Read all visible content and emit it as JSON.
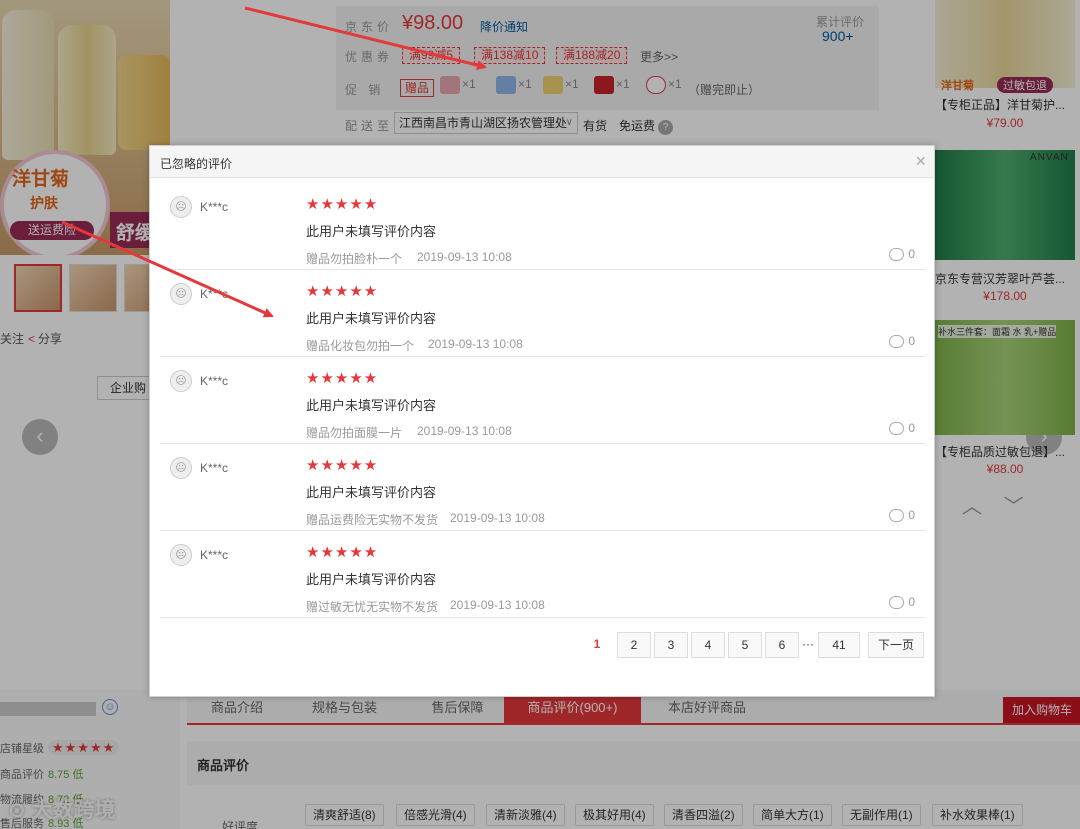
{
  "hero": {
    "caption_main": "洋甘菊",
    "caption_sub": "护肤",
    "caption_badge": "送运费险",
    "caption_side": "舒缓"
  },
  "actions": {
    "follow": "关注",
    "share": "分享",
    "enterprise_buy": "企业购"
  },
  "price": {
    "jd_label": "京东价",
    "jd_price": "¥98.00",
    "notify": "降价通知",
    "total_reviews_label": "累计评价",
    "total_reviews": "900+",
    "coupon_label": "优惠券",
    "coupons": [
      "满99减5",
      "满138减10",
      "满188减20"
    ],
    "more": "更多>>",
    "promo_label": "促 销",
    "gift_tag": "赠品",
    "gifts": [
      "×1",
      "×1",
      "×1",
      "×1",
      "×1"
    ],
    "gift_note": "（赠完即止）",
    "ship_to_label": "配送至",
    "address": "江西南昌市青山湖区扬农管理处",
    "stock": "有货",
    "shipping": "免运费"
  },
  "recommend": [
    {
      "badge1": "洋甘菊",
      "badge2": "过敏包退",
      "title": "【专柜正品】洋甘菊护...",
      "price": "¥79.00"
    },
    {
      "brand": "ANVAN",
      "title": "京东专营汉芳翠叶芦荟...",
      "price": "¥178.00"
    },
    {
      "badge": "补水三件套：面霜 水 乳+赠品",
      "title": "【专柜品质过敏包退】...",
      "price": "¥88.00"
    }
  ],
  "tabs": [
    "商品介绍",
    "规格与包装",
    "售后保障",
    "商品评价(900+)",
    "本店好评商品"
  ],
  "cart_button": "加入购物车",
  "store": {
    "rating_label": "店铺星级",
    "product_score_label": "商品评价",
    "product_score": "8.75 低",
    "logistics_label": "物流履约",
    "logistics": "8.72 低",
    "service_label": "售后服务",
    "service": "8.93 低"
  },
  "review_section": {
    "title": "商品评价",
    "praise_label": "好评度",
    "tags": [
      "清爽舒适(8)",
      "倍感光滑(4)",
      "清新淡雅(4)",
      "极其好用(4)",
      "清香四溢(2)",
      "简单大方(1)",
      "无副作用(1)",
      "补水效果棒(1)"
    ]
  },
  "watermark": "大数跨境",
  "modal": {
    "title": "已忽略的评价",
    "close": "×",
    "reviews": [
      {
        "user": "K***c",
        "stars": "★★★★★",
        "text": "此用户未填写评价内容",
        "product": "赠品勿拍脸朴一个",
        "time": "2019-09-13 10:08",
        "comments": "0"
      },
      {
        "user": "K***c",
        "stars": "★★★★★",
        "text": "此用户未填写评价内容",
        "product": "赠品化妆包勿拍一个",
        "time": "2019-09-13 10:08",
        "comments": "0"
      },
      {
        "user": "K***c",
        "stars": "★★★★★",
        "text": "此用户未填写评价内容",
        "product": "赠品勿拍面膜一片",
        "time": "2019-09-13 10:08",
        "comments": "0"
      },
      {
        "user": "K***c",
        "stars": "★★★★★",
        "text": "此用户未填写评价内容",
        "product": "赠品运费险无实物不发货",
        "time": "2019-09-13 10:08",
        "comments": "0"
      },
      {
        "user": "K***c",
        "stars": "★★★★★",
        "text": "此用户未填写评价内容",
        "product": "赠过敏无忧无实物不发货",
        "time": "2019-09-13 10:08",
        "comments": "0"
      }
    ],
    "pager": {
      "current": "1",
      "pages": [
        "2",
        "3",
        "4",
        "5",
        "6"
      ],
      "ellipsis": "···",
      "last": "41",
      "next": "下一页"
    }
  },
  "colors": {
    "accent": "#e4393c",
    "link": "#005aa0",
    "good": "#5ba532",
    "arrow": "#e4393c"
  }
}
